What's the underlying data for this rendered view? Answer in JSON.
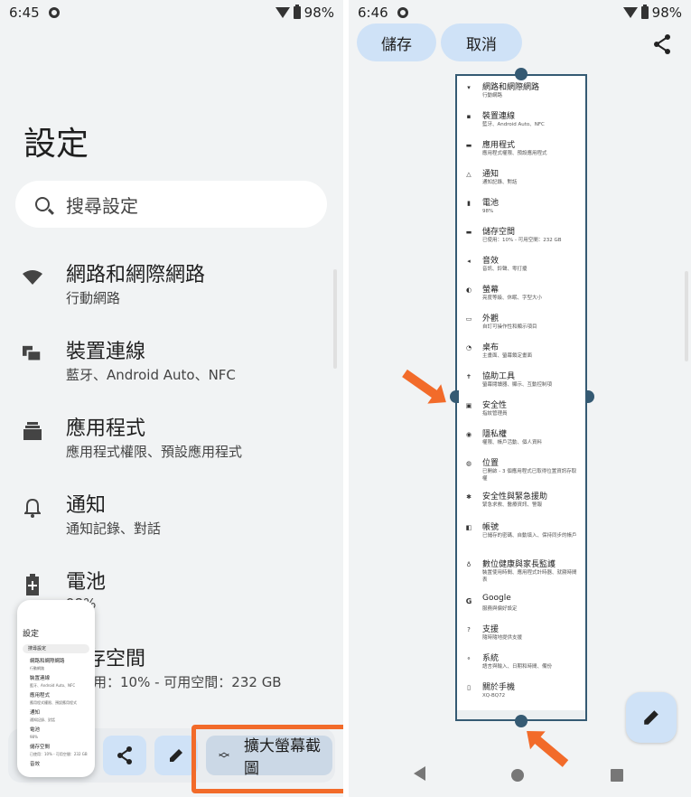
{
  "left": {
    "status": {
      "time": "6:45",
      "battery": "98%"
    },
    "title": "設定",
    "search_placeholder": "搜尋設定",
    "items": [
      {
        "title": "網路和網際網路",
        "subtitle": "行動網路",
        "icon": "wifi-icon"
      },
      {
        "title": "裝置連線",
        "subtitle": "藍牙、Android Auto、NFC",
        "icon": "devices-icon"
      },
      {
        "title": "應用程式",
        "subtitle": "應用程式權限、預設應用程式",
        "icon": "apps-icon"
      },
      {
        "title": "通知",
        "subtitle": "通知記錄、對話",
        "icon": "bell-icon"
      },
      {
        "title": "電池",
        "subtitle": "98%",
        "icon": "battery-icon"
      },
      {
        "title": "儲存空間",
        "subtitle": "已使用：10% - 可用空間：232 GB",
        "icon": "storage-icon"
      }
    ],
    "thumbnail": {
      "title": "設定",
      "search": "搜尋設定",
      "items": [
        {
          "title": "網路和網際網路",
          "subtitle": "行動網路"
        },
        {
          "title": "裝置連線",
          "subtitle": "藍牙、Android Auto、NFC"
        },
        {
          "title": "應用程式",
          "subtitle": "應用程式權限、預設應用程式"
        },
        {
          "title": "通知",
          "subtitle": "通知記錄、對話"
        },
        {
          "title": "電池",
          "subtitle": "98%"
        },
        {
          "title": "儲存空間",
          "subtitle": "已使用：10% - 可用空間：232 GB"
        },
        {
          "title": "音效",
          "subtitle": ""
        }
      ]
    },
    "expand_label": "擴大螢幕截圖"
  },
  "right": {
    "status": {
      "time": "6:46",
      "battery": "98%"
    },
    "save_label": "儲存",
    "cancel_label": "取消",
    "items": [
      {
        "title": "網路和網際網路",
        "subtitle": "行動網路",
        "icon": "wifi-icon"
      },
      {
        "title": "裝置連線",
        "subtitle": "藍牙、Android Auto、NFC",
        "icon": "devices-icon"
      },
      {
        "title": "應用程式",
        "subtitle": "應用程式權限、預設應用程式",
        "icon": "apps-icon"
      },
      {
        "title": "通知",
        "subtitle": "通知記錄、對話",
        "icon": "bell-icon"
      },
      {
        "title": "電池",
        "subtitle": "98%",
        "icon": "battery-icon"
      },
      {
        "title": "儲存空間",
        "subtitle": "已使用：10% - 可用空間：232 GB",
        "icon": "storage-icon"
      },
      {
        "title": "音效",
        "subtitle": "音訊、鈴聲、零打擾",
        "icon": "sound-icon"
      },
      {
        "title": "螢幕",
        "subtitle": "亮度等級、休眠、字型大小",
        "icon": "display-icon"
      },
      {
        "title": "外觀",
        "subtitle": "自訂可操作性和顯示項目",
        "icon": "appearance-icon"
      },
      {
        "title": "桌布",
        "subtitle": "主畫面、螢幕鎖定畫面",
        "icon": "wallpaper-icon"
      },
      {
        "title": "協助工具",
        "subtitle": "螢幕閱讀器、顯示、互動控制項",
        "icon": "accessibility-icon"
      },
      {
        "title": "安全性",
        "subtitle": "指紋管理員",
        "icon": "lock-icon"
      },
      {
        "title": "隱私權",
        "subtitle": "權限、帳戶活動、個人資料",
        "icon": "privacy-icon"
      },
      {
        "title": "位置",
        "subtitle": "已開啟 - 3 個應用程式已取得位置資訊存取權",
        "icon": "location-icon"
      },
      {
        "title": "安全性與緊急援助",
        "subtitle": "緊急求救、醫療資訊、警報",
        "icon": "emergency-icon"
      },
      {
        "title": "帳號",
        "subtitle": "已儲存的密碼、自動填入、保持同步的帳戶",
        "icon": "account-icon"
      },
      {
        "title": "數位健康與家長監護",
        "subtitle": "裝置使用時間、應用程式計時器、就寢時間表",
        "icon": "wellbeing-icon"
      },
      {
        "title": "Google",
        "subtitle": "服務與偏好設定",
        "icon": "google-icon"
      },
      {
        "title": "支援",
        "subtitle": "隨時隨地提供支援",
        "icon": "help-icon"
      },
      {
        "title": "系統",
        "subtitle": "語言與輸入、日期和時間、備份",
        "icon": "system-icon"
      },
      {
        "title": "關於手機",
        "subtitle": "XQ-BQ72",
        "icon": "phone-icon"
      }
    ]
  },
  "colors": {
    "accent_orange": "#f26b2a",
    "crop_border": "#355a73",
    "button_blue": "#cfe2f7"
  }
}
